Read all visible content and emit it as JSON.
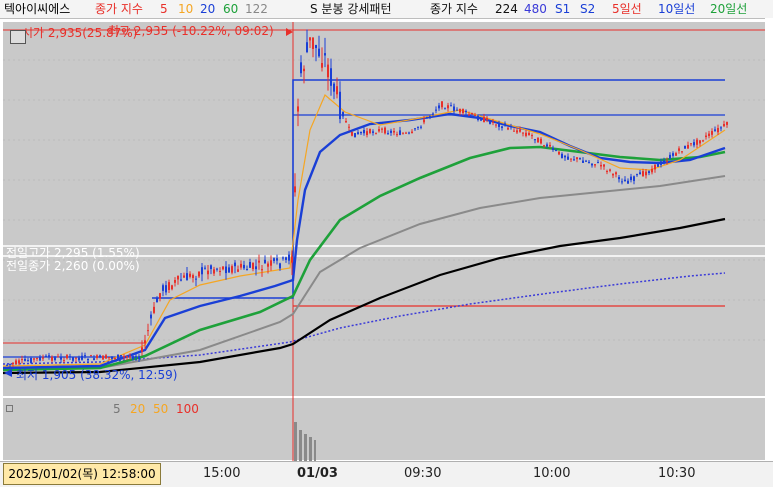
{
  "legend": {
    "stock_name": "텍아이씨에스",
    "ma_label": "종가 지수",
    "ma_periods": [
      "5",
      "10",
      "20",
      "60",
      "122"
    ],
    "pattern_label": "S 분봉 강세패턴",
    "ma2_label": "종가 지수",
    "ma2_periods": [
      "224",
      "480"
    ],
    "s1": "S1",
    "s2": "S2",
    "day5": "5일선",
    "day10": "10일선",
    "day20": "20일선"
  },
  "annotations": {
    "open_price": "시가 2,935(25.87%)",
    "high_price": "최고 2,935 (-10.22%, 09:02)",
    "prev_high": "전일고가 2,295 (1.55%)",
    "prev_close": "전일종가 2,260 (0.00%)",
    "low_price": "최저 1,905 (38.32%, 12:59)"
  },
  "volume_legend": [
    "5",
    "20",
    "50",
    "100"
  ],
  "time_axis": {
    "cursor_label": "2025/01/02(목) 12:58:00",
    "ticks": [
      "15:00",
      "01/03",
      "09:30",
      "10:00",
      "10:30"
    ]
  },
  "colors": {
    "ma5": "#e8302a",
    "ma10": "#f5a623",
    "ma20": "#1a3fd6",
    "ma60": "#1ea13a",
    "ma122": "#888888",
    "ma224": "#000000",
    "ma480": "#3a3ad8",
    "up_candle": "#e8302a",
    "down_candle": "#1a3fd6"
  }
}
